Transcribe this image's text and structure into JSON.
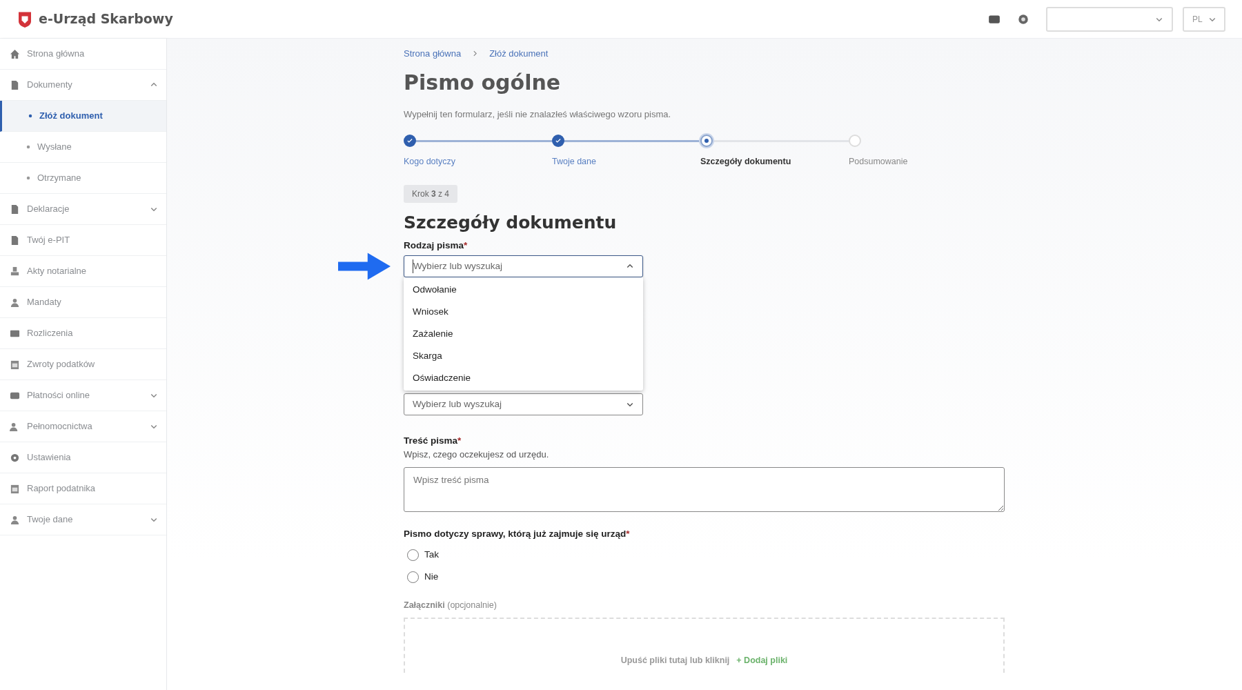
{
  "header": {
    "title": "e-Urząd Skarbowy",
    "language_select": {
      "value": "PL"
    }
  },
  "sidebar": {
    "items": [
      {
        "label": "Strona główna",
        "selected": false
      },
      {
        "label": "Dokumenty",
        "selected": false,
        "expanded": true,
        "children": [
          {
            "label": "Złóż dokument",
            "selected": true
          },
          {
            "label": "Wysłane",
            "selected": false
          },
          {
            "label": "Otrzymane",
            "selected": false
          }
        ]
      },
      {
        "label": "Deklaracje",
        "selected": false,
        "expanded": false
      },
      {
        "label": "Twój e-PIT",
        "selected": false
      },
      {
        "label": "Akty notarialne",
        "selected": false
      },
      {
        "label": "Mandaty",
        "selected": false
      },
      {
        "label": "Rozliczenia",
        "selected": false
      },
      {
        "label": "Zwroty podatków",
        "selected": false
      },
      {
        "label": "Płatności online",
        "selected": false,
        "expanded": false
      },
      {
        "label": "Pełnomocnictwa",
        "selected": false,
        "expanded": false
      },
      {
        "label": "Ustawienia",
        "selected": false
      },
      {
        "label": "Raport podatnika",
        "selected": false
      },
      {
        "label": "Twoje dane",
        "selected": false,
        "expanded": false
      }
    ]
  },
  "breadcrumb": [
    "Strona główna",
    "Złóż dokument"
  ],
  "page_title": "Pismo ogólne",
  "intro": "Wypełnij ten formularz, jeśli nie znalazłeś właściwego wzoru pisma.",
  "steps": [
    {
      "label": "Kogo dotyczy",
      "completed": true,
      "selected": false
    },
    {
      "label": "Twoje dane",
      "completed": true,
      "selected": false
    },
    {
      "label": "Szczegóły dokumentu",
      "completed": false,
      "selected": true
    },
    {
      "label": "Podsumowanie",
      "completed": false,
      "selected": false
    }
  ],
  "step_badge": "Krok **3** z 4",
  "section_title": "Szczegóły dokumentu",
  "letter_type": {
    "label": "Rodzaj pisma",
    "required_mark": "*",
    "placeholder": "Wybierz lub wyszukaj",
    "expanded": true,
    "options": [
      "Odwołanie",
      "Wniosek",
      "Zażalenie",
      "Skarga",
      "Oświadczenie"
    ]
  },
  "second_select": {
    "placeholder": "Wybierz lub wyszukaj",
    "expanded": false
  },
  "content": {
    "label": "Treść pisma",
    "required_mark": "*",
    "hint": "Wpisz, czego oczekujesz od urzędu.",
    "placeholder": "Wpisz treść pisma"
  },
  "ongoing_case": {
    "label": "Pismo dotyczy sprawy, którą już zajmuje się urząd",
    "required_mark": "*",
    "options": [
      {
        "label": "Tak",
        "selected": false
      },
      {
        "label": "Nie",
        "selected": false
      }
    ]
  },
  "attachments": {
    "label": "Załączniki",
    "note": "(opcjonalnie)",
    "drop_text": "Upuść pliki tutaj lub kliknij",
    "add_link": "+ Dodaj pliki"
  }
}
